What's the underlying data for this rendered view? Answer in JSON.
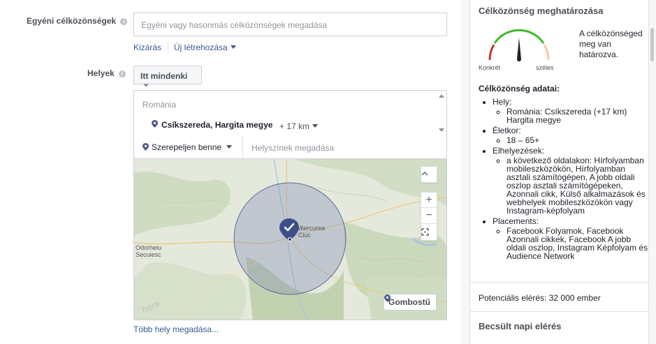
{
  "form": {
    "custom_audiences": {
      "label": "Egyéni célközönségek",
      "placeholder": "Egyéni vagy hasonmás célközönségek megadása",
      "exclude_link": "Kizárás",
      "create_new_link": "Új létrehozása"
    },
    "locations": {
      "label": "Helyek",
      "type_dropdown": "Itt mindenki",
      "country": "Románia",
      "city": "Csíkszereda, Hargita megye",
      "radius": "+ 17 km",
      "include_dropdown": "Szerepeljen benne",
      "search_placeholder": "Helyszínek megadása",
      "more_locations_link": "Több hely megadása..."
    },
    "map": {
      "city_label_1": "Miercurea",
      "city_label_2": "Ciuc",
      "town_label_1": "Odorheiu",
      "town_label_2": "Secuiesc",
      "watermark": "here",
      "pin_button": "Gombostű",
      "zoom_in": "+",
      "zoom_out": "−"
    }
  },
  "panel": {
    "title": "Célközönség meghatározása",
    "gauge_description": "A célközönséged meg van határozva.",
    "gauge_left_label": "Konkrét",
    "gauge_right_label": "széles",
    "details_title": "Célközönség adatai:",
    "details": [
      {
        "label": "Hely:",
        "items": [
          "Románia: Csíkszereda (+17 km) Hargita megye"
        ]
      },
      {
        "label": "Életkor:",
        "items": [
          "18 – 65+"
        ]
      },
      {
        "label": "Elhelyezések:",
        "items": [
          "a következő oldalakon: Hírfolyamban mobileszközökön, Hírfolyamban asztali számítógépen, A jobb oldali oszlop asztali számítógépeken, Azonnali cikk, Külső alkalmazások és webhelyek mobileszközökön vagy Instagram-képfolyam"
        ]
      },
      {
        "label": "Placements:",
        "items": [
          "Facebook Folyamok, Facebook Azonnali cikkek, Facebook A jobb oldali oszlop, Instagram Képfolyam és Audience Network"
        ]
      }
    ],
    "potential_reach": "Potenciális elérés: 32 000 ember",
    "daily_reach_title": "Becsült napi elérés"
  },
  "colors": {
    "link": "#365899",
    "gauge_red": "#c0392b",
    "gauge_green": "#42b72a",
    "gauge_peach": "#f6c99c",
    "radius_fill": "#8a94b8"
  }
}
